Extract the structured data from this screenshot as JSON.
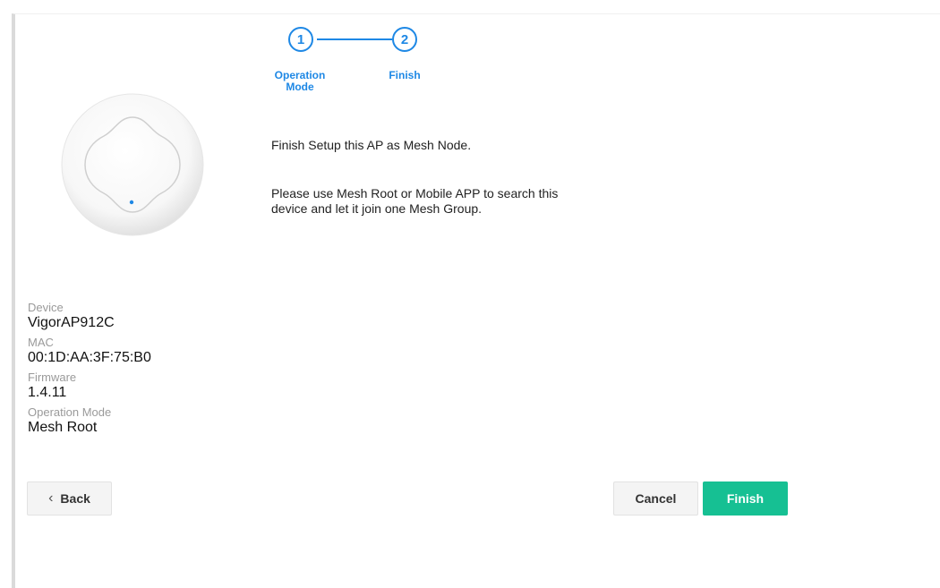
{
  "stepper": {
    "steps": [
      {
        "number": "1",
        "label_line1": "Operation",
        "label_line2": "Mode"
      },
      {
        "number": "2",
        "label_line1": "Finish",
        "label_line2": ""
      }
    ],
    "accent_color": "#1e88e5"
  },
  "message": {
    "line1": "Finish Setup this AP as Mesh Node.",
    "line2": "Please use Mesh Root or Mobile APP to search this",
    "line3": "device and let it join one Mesh Group."
  },
  "device_info": {
    "device_label": "Device",
    "device_value": "VigorAP912C",
    "mac_label": "MAC",
    "mac_value": "00:1D:AA:3F:75:B0",
    "firmware_label": "Firmware",
    "firmware_value": "1.4.11",
    "opmode_label": "Operation Mode",
    "opmode_value": "Mesh Root"
  },
  "buttons": {
    "back": "Back",
    "cancel": "Cancel",
    "finish": "Finish",
    "finish_color": "#16c093"
  },
  "icons": {
    "back": "chevron-left-icon",
    "device": "access-point-device-icon"
  }
}
